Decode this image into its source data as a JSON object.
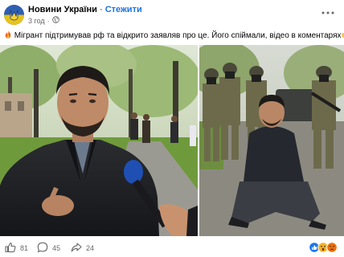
{
  "post": {
    "page_name": "Новини України",
    "separator": " · ",
    "follow_label": "Стежити",
    "time": "3 год",
    "meta_separator": "·",
    "text": "Мігрант підтримував рф та відкрито заявляв про це. Його спіймали, відео в коментарях"
  },
  "actions": {
    "likes": "81",
    "comments": "45",
    "shares": "24"
  },
  "icons": {
    "fire": "fire-icon",
    "point": "pointing-hand-icon",
    "globe": "globe-icon",
    "more": "more-icon",
    "close": "close-icon",
    "like": "like-icon",
    "comment": "comment-icon",
    "share": "share-icon"
  },
  "colors": {
    "accent": "#1b74e4",
    "secondary_text": "#65676b",
    "like_blue": "#1877f2"
  }
}
